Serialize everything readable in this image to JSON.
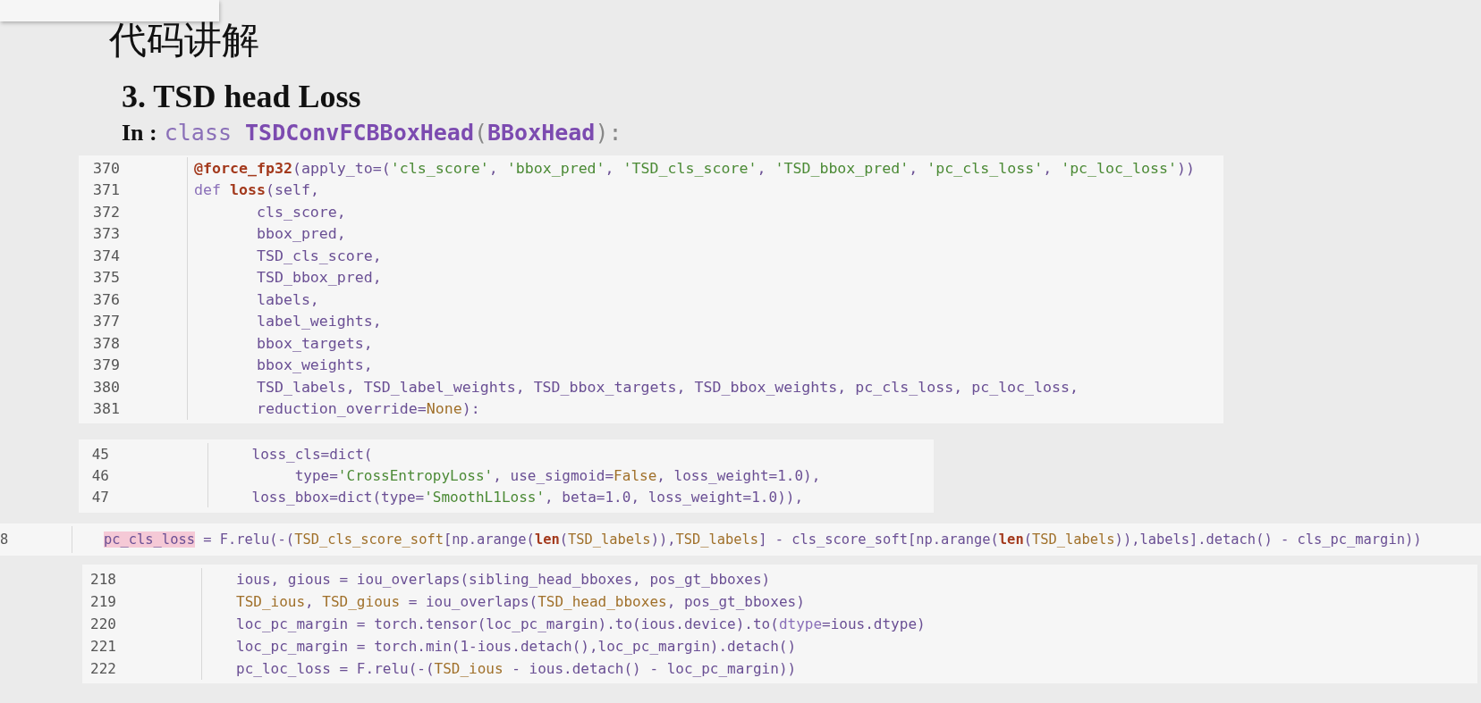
{
  "title": "代码讲解",
  "subtitle": "3. TSD head Loss",
  "class_line": {
    "label": "In :",
    "code": [
      {
        "kind": "keyword",
        "text": "class "
      },
      {
        "kind": "classname",
        "text": "TSDConvFCBBoxHead"
      },
      {
        "kind": "punct",
        "text": "("
      },
      {
        "kind": "classname",
        "text": "BBoxHead"
      },
      {
        "kind": "punct",
        "text": "):"
      }
    ]
  },
  "code_blocks": [
    {
      "lines": [
        {
          "number": "370",
          "tokens": [
            {
              "kind": "func",
              "text": "@force_fp32"
            },
            {
              "kind": "plain",
              "text": "(apply_to=("
            },
            {
              "kind": "string",
              "text": "'cls_score'"
            },
            {
              "kind": "plain",
              "text": ", "
            },
            {
              "kind": "string",
              "text": "'bbox_pred'"
            },
            {
              "kind": "plain",
              "text": ", "
            },
            {
              "kind": "string",
              "text": "'TSD_cls_score'"
            },
            {
              "kind": "plain",
              "text": ", "
            },
            {
              "kind": "string",
              "text": "'TSD_bbox_pred'"
            },
            {
              "kind": "plain",
              "text": ", "
            },
            {
              "kind": "string",
              "text": "'pc_cls_loss'"
            },
            {
              "kind": "plain",
              "text": ", "
            },
            {
              "kind": "string",
              "text": "'pc_loc_loss'"
            },
            {
              "kind": "plain",
              "text": "))"
            }
          ]
        },
        {
          "number": "371",
          "tokens": [
            {
              "kind": "keyword",
              "text": "def "
            },
            {
              "kind": "func",
              "text": "loss"
            },
            {
              "kind": "plain",
              "text": "(self,"
            }
          ]
        },
        {
          "number": "372",
          "tokens": [
            {
              "kind": "plain",
              "text": "       cls_score,"
            }
          ]
        },
        {
          "number": "373",
          "tokens": [
            {
              "kind": "plain",
              "text": "       bbox_pred,"
            }
          ]
        },
        {
          "number": "374",
          "tokens": [
            {
              "kind": "plain",
              "text": "       TSD_cls_score,"
            }
          ]
        },
        {
          "number": "375",
          "tokens": [
            {
              "kind": "plain",
              "text": "       TSD_bbox_pred,"
            }
          ]
        },
        {
          "number": "376",
          "tokens": [
            {
              "kind": "plain",
              "text": "       labels,"
            }
          ]
        },
        {
          "number": "377",
          "tokens": [
            {
              "kind": "plain",
              "text": "       label_weights,"
            }
          ]
        },
        {
          "number": "378",
          "tokens": [
            {
              "kind": "plain",
              "text": "       bbox_targets,"
            }
          ]
        },
        {
          "number": "379",
          "tokens": [
            {
              "kind": "plain",
              "text": "       bbox_weights,"
            }
          ]
        },
        {
          "number": "380",
          "tokens": [
            {
              "kind": "plain",
              "text": "       TSD_labels, TSD_label_weights, TSD_bbox_targets, TSD_bbox_weights, pc_cls_loss, pc_loc_loss,"
            }
          ]
        },
        {
          "number": "381",
          "tokens": [
            {
              "kind": "plain",
              "text": "       reduction_override="
            },
            {
              "kind": "constant",
              "text": "None"
            },
            {
              "kind": "plain",
              "text": "):"
            }
          ]
        }
      ]
    },
    {
      "lines": [
        {
          "number": "45",
          "tokens": [
            {
              "kind": "plain",
              "text": "    loss_cls=dict("
            }
          ]
        },
        {
          "number": "46",
          "tokens": [
            {
              "kind": "plain",
              "text": "         type="
            },
            {
              "kind": "string",
              "text": "'CrossEntropyLoss'"
            },
            {
              "kind": "plain",
              "text": ", use_sigmoid="
            },
            {
              "kind": "constant",
              "text": "False"
            },
            {
              "kind": "plain",
              "text": ", loss_weight=1.0),"
            }
          ]
        },
        {
          "number": "47",
          "tokens": [
            {
              "kind": "plain",
              "text": "    loss_bbox=dict(type="
            },
            {
              "kind": "string",
              "text": "'SmoothL1Loss'"
            },
            {
              "kind": "plain",
              "text": ", beta=1.0, loss_weight=1.0)),"
            }
          ]
        }
      ]
    },
    {
      "lines": [
        {
          "number": "8",
          "tokens": [
            {
              "kind": "highlight",
              "text": "pc_cls_loss"
            },
            {
              "kind": "plain",
              "text": " = F.relu(-("
            },
            {
              "kind": "constant",
              "text": "TSD_cls_score_soft"
            },
            {
              "kind": "plain",
              "text": "[np.arange("
            },
            {
              "kind": "func",
              "text": "len"
            },
            {
              "kind": "plain",
              "text": "("
            },
            {
              "kind": "constant",
              "text": "TSD_labels"
            },
            {
              "kind": "plain",
              "text": ")),"
            },
            {
              "kind": "constant",
              "text": "TSD_labels"
            },
            {
              "kind": "plain",
              "text": "] - cls_score_soft[np.arange("
            },
            {
              "kind": "func",
              "text": "len"
            },
            {
              "kind": "plain",
              "text": "("
            },
            {
              "kind": "constant",
              "text": "TSD_labels"
            },
            {
              "kind": "plain",
              "text": ")),labels].detach() - cls_pc_margin))"
            }
          ]
        }
      ]
    },
    {
      "lines": [
        {
          "number": "218",
          "tokens": [
            {
              "kind": "plain",
              "text": "ious, gious = iou_overlaps(sibling_head_bboxes, pos_gt_bboxes)"
            }
          ]
        },
        {
          "number": "219",
          "tokens": [
            {
              "kind": "constant",
              "text": "TSD_ious"
            },
            {
              "kind": "plain",
              "text": ", "
            },
            {
              "kind": "constant",
              "text": "TSD_gious"
            },
            {
              "kind": "plain",
              "text": " = iou_overlaps("
            },
            {
              "kind": "constant",
              "text": "TSD_head_bboxes"
            },
            {
              "kind": "plain",
              "text": ", pos_gt_bboxes)"
            }
          ]
        },
        {
          "number": "220",
          "tokens": [
            {
              "kind": "plain",
              "text": "loc_pc_margin = torch.tensor(loc_pc_margin).to(ious.device).to("
            },
            {
              "kind": "keyword",
              "text": "dtype"
            },
            {
              "kind": "plain",
              "text": "=ious.dtype)"
            }
          ]
        },
        {
          "number": "221",
          "tokens": [
            {
              "kind": "plain",
              "text": "loc_pc_margin = torch.min(1-ious.detach(),loc_pc_margin).detach()"
            }
          ]
        },
        {
          "number": "222",
          "tokens": [
            {
              "kind": "plain",
              "text": "pc_loc_loss = F.relu(-("
            },
            {
              "kind": "constant",
              "text": "TSD_ious"
            },
            {
              "kind": "plain",
              "text": " - ious.detach() - loc_pc_margin))"
            }
          ]
        }
      ]
    }
  ]
}
